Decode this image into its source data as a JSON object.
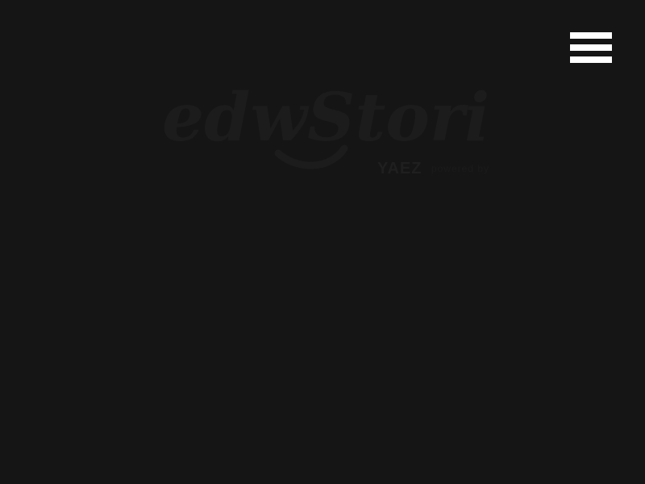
{
  "logo": {
    "script_text": "edwStories",
    "byline_prefix": "powered by",
    "brand": "YAEZ"
  },
  "menu": {
    "icon": "hamburger-menu-icon"
  },
  "colors": {
    "background": "#151515",
    "menu_icon": "#ffffff",
    "logo": "#1c1c1c"
  }
}
